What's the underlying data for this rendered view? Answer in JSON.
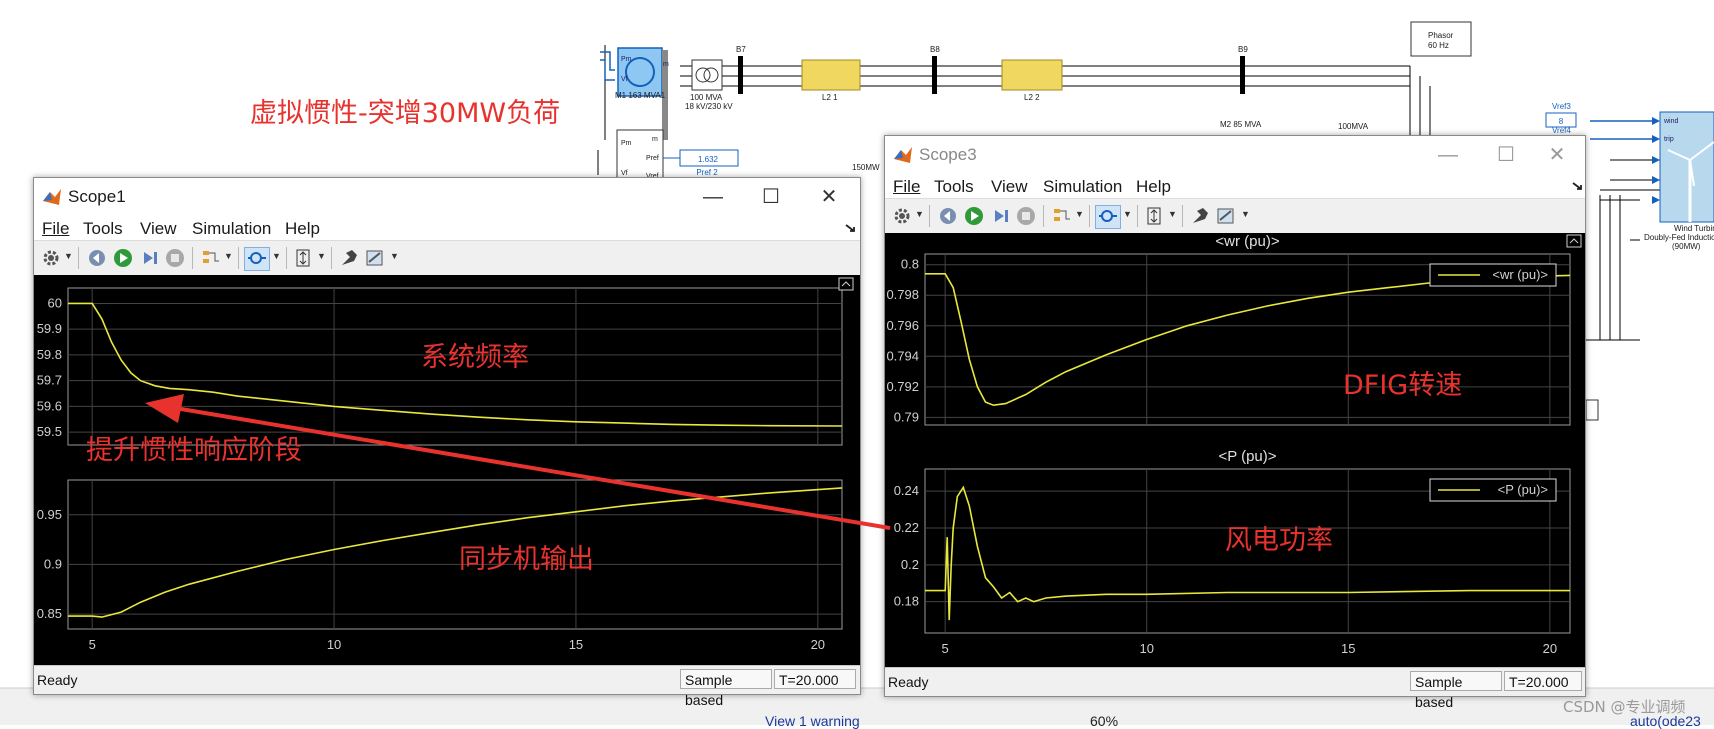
{
  "diagram": {
    "blocks": {
      "m1_label": "M1 163 MVA1",
      "m1_pm": "Pm",
      "m1_vf": "Vf",
      "m1_m": "m",
      "tr1_label": "100 MVA",
      "tr1_sub": "18 kV/230 kV",
      "b7": "B7",
      "b8": "B8",
      "b9": "B9",
      "l21": "L2 1",
      "l22": "L2 2",
      "phasor": "Phasor",
      "phasor_sub": "60 Hz",
      "pref_value": "1.632",
      "pref_label": "Pref 2",
      "gov_pm": "Pm",
      "gov_m": "m",
      "gov_pref": "Pref",
      "gov_vf": "Vf",
      "gov_vref": "Vref",
      "load_label": "150MW",
      "m2_label": "M2 85 MVA",
      "tr2_label": "100MVA",
      "vref3": "Vref3",
      "vref3_val": "8",
      "vref4": "Vref4",
      "wind_in": "wind",
      "trip_in": "trip",
      "wt_label1": "Wind Turbin",
      "wt_label2": "Doubly-Fed Inductio",
      "wt_label3": "(90MW)"
    },
    "title_annotation": "虚拟惯性-突增30MW负荷",
    "bottom": {
      "warning": "View 1 warning",
      "zoom": "60%",
      "solver": "auto(ode23",
      "watermark": "CSDN @专业调频"
    }
  },
  "scope1": {
    "title": "Scope1",
    "menus": [
      "File",
      "Tools",
      "View",
      "Simulation",
      "Help"
    ],
    "status": "Ready",
    "sample": "Sample based",
    "time": "T=20.000",
    "annotations": {
      "freq": "系统频率",
      "inertia": "提升惯性响应阶段",
      "sync": "同步机输出"
    },
    "axes": [
      {
        "yticks": [
          "60",
          "59.9",
          "59.8",
          "59.7",
          "59.6",
          "59.5"
        ]
      },
      {
        "yticks": [
          "0.95",
          "0.9",
          "0.85"
        ],
        "xticks": [
          "5",
          "10",
          "15",
          "20"
        ]
      }
    ]
  },
  "scope3": {
    "title": "Scope3",
    "menus": [
      "File",
      "Tools",
      "View",
      "Simulation",
      "Help"
    ],
    "status": "Ready",
    "sample": "Sample based",
    "time": "T=20.000",
    "annotations": {
      "dfig": "DFIG转速",
      "wind": "风电功率"
    },
    "axes": [
      {
        "title": "<wr (pu)>",
        "legend": "<wr (pu)>",
        "yticks": [
          "0.8",
          "0.798",
          "0.796",
          "0.794",
          "0.792",
          "0.79"
        ]
      },
      {
        "title": "<P (pu)>",
        "legend": "<P (pu)>",
        "yticks": [
          "0.24",
          "0.22",
          "0.2",
          "0.18"
        ],
        "xticks": [
          "5",
          "10",
          "15",
          "20"
        ]
      }
    ]
  },
  "colors": {
    "trace": "#e8e83c",
    "annotation": "#e8322e",
    "plot_bg": "#000000"
  },
  "chart_data": [
    {
      "type": "line",
      "title": "",
      "xlim": [
        4.5,
        20.5
      ],
      "ylim": [
        59.45,
        60.06
      ],
      "grid": true,
      "series": [
        {
          "x": [
            4.5,
            5.0,
            5.2,
            5.4,
            5.6,
            5.8,
            6.0,
            6.3,
            6.6,
            7.0,
            7.5,
            8,
            9,
            10,
            11,
            12,
            13,
            14,
            15,
            16,
            17,
            18,
            19,
            20.5
          ],
          "y": [
            60.0,
            60.0,
            59.94,
            59.85,
            59.78,
            59.73,
            59.7,
            59.68,
            59.67,
            59.665,
            59.655,
            59.64,
            59.62,
            59.6,
            59.585,
            59.57,
            59.558,
            59.548,
            59.54,
            59.535,
            59.53,
            59.527,
            59.525,
            59.524
          ]
        }
      ]
    },
    {
      "type": "line",
      "title": "",
      "xlim": [
        4.5,
        20.5
      ],
      "ylim": [
        0.835,
        0.985
      ],
      "grid": true,
      "series": [
        {
          "x": [
            4.5,
            5.0,
            5.2,
            5.6,
            6.0,
            6.5,
            7,
            8,
            9,
            10,
            11,
            12,
            13,
            14,
            15,
            16,
            17,
            18,
            19,
            20.5
          ],
          "y": [
            0.848,
            0.848,
            0.847,
            0.852,
            0.862,
            0.872,
            0.88,
            0.893,
            0.905,
            0.915,
            0.924,
            0.932,
            0.94,
            0.947,
            0.953,
            0.959,
            0.964,
            0.968,
            0.972,
            0.977
          ]
        }
      ]
    },
    {
      "type": "line",
      "title": "<wr (pu)>",
      "legend": "<wr (pu)>",
      "xlim": [
        4.5,
        20.5
      ],
      "ylim": [
        0.7895,
        0.8007
      ],
      "grid": true,
      "series": [
        {
          "name": "<wr (pu)>",
          "x": [
            4.5,
            5.0,
            5.2,
            5.4,
            5.6,
            5.8,
            6.0,
            6.2,
            6.5,
            7.0,
            7.5,
            8,
            9,
            10,
            11,
            12,
            13,
            14,
            15,
            16,
            17,
            18,
            19,
            20.5
          ],
          "y": [
            0.7994,
            0.7994,
            0.7985,
            0.7962,
            0.7938,
            0.792,
            0.791,
            0.7908,
            0.7909,
            0.7915,
            0.7923,
            0.793,
            0.7941,
            0.7951,
            0.796,
            0.7967,
            0.7973,
            0.7978,
            0.7982,
            0.7985,
            0.7988,
            0.799,
            0.7992,
            0.7993
          ]
        }
      ]
    },
    {
      "type": "line",
      "title": "<P (pu)>",
      "legend": "<P (pu)>",
      "xlim": [
        4.5,
        20.5
      ],
      "ylim": [
        0.163,
        0.252
      ],
      "grid": true,
      "series": [
        {
          "name": "<P (pu)>",
          "x": [
            4.5,
            5.0,
            5.05,
            5.1,
            5.15,
            5.2,
            5.3,
            5.45,
            5.6,
            5.8,
            6.0,
            6.2,
            6.4,
            6.6,
            6.8,
            7.0,
            7.2,
            7.5,
            8,
            9,
            10,
            12,
            15,
            18,
            20.5
          ],
          "y": [
            0.186,
            0.186,
            0.215,
            0.17,
            0.2,
            0.22,
            0.237,
            0.242,
            0.232,
            0.21,
            0.193,
            0.188,
            0.182,
            0.185,
            0.18,
            0.182,
            0.18,
            0.182,
            0.183,
            0.184,
            0.184,
            0.185,
            0.185,
            0.186,
            0.186
          ]
        }
      ]
    }
  ]
}
